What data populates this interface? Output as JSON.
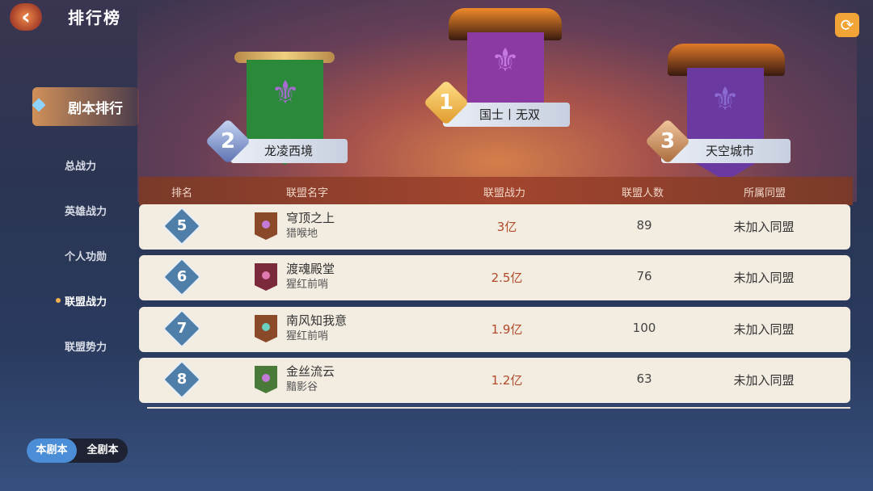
{
  "header": {
    "title": "排行榜",
    "back_icon": "back-arrow-icon",
    "refresh_icon": "refresh-icon"
  },
  "sidebar": {
    "active": "剧本排行",
    "items": [
      {
        "label": "总战力",
        "selected": false
      },
      {
        "label": "英雄战力",
        "selected": false
      },
      {
        "label": "个人功勋",
        "selected": false
      },
      {
        "label": "联盟战力",
        "selected": true
      },
      {
        "label": "联盟势力",
        "selected": false
      }
    ]
  },
  "toggle": {
    "on": "本剧本",
    "off": "全剧本"
  },
  "podium": [
    {
      "rank": "1",
      "name": "国士丨无双",
      "color": "#8a3aa0"
    },
    {
      "rank": "2",
      "name": "龙凌西境",
      "color": "#2a8a3a"
    },
    {
      "rank": "3",
      "name": "天空城市",
      "color": "#6a3aa0"
    }
  ],
  "table": {
    "headers": [
      "排名",
      "联盟名字",
      "联盟战力",
      "联盟人数",
      "所属同盟"
    ],
    "rows": [
      {
        "rank": "5",
        "name": "穹顶之上",
        "sub": "猎喉地",
        "power": "3亿",
        "members": "89",
        "ally": "未加入同盟",
        "emblem": "#8a4a2a"
      },
      {
        "rank": "6",
        "name": "渡魂殿堂",
        "sub": "猩红前哨",
        "power": "2.5亿",
        "members": "76",
        "ally": "未加入同盟",
        "emblem": "#7a2a3a"
      },
      {
        "rank": "7",
        "name": "南风知我意",
        "sub": "猩红前哨",
        "power": "1.9亿",
        "members": "100",
        "ally": "未加入同盟",
        "emblem": "#8a4a2a"
      },
      {
        "rank": "8",
        "name": "金丝流云",
        "sub": "黯影谷",
        "power": "1.2亿",
        "members": "63",
        "ally": "未加入同盟",
        "emblem": "#4a7a3a"
      }
    ]
  }
}
